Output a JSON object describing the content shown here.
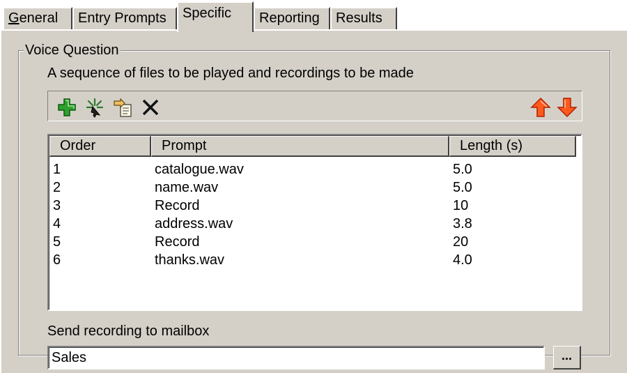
{
  "tabs": [
    {
      "label": "General",
      "access_key": "G",
      "rest": "eneral",
      "active": false
    },
    {
      "label": "Entry Prompts",
      "active": false
    },
    {
      "label": "Specific",
      "active": true
    },
    {
      "label": "Reporting",
      "active": false
    },
    {
      "label": "Results",
      "active": false
    }
  ],
  "group": {
    "title": "Voice Question",
    "description": "A sequence of files to be played and recordings to be made"
  },
  "toolbar": {
    "buttons": [
      {
        "icon": "add-icon",
        "tooltip": ""
      },
      {
        "icon": "new-recording-icon",
        "tooltip": ""
      },
      {
        "icon": "edit-icon",
        "tooltip": ""
      },
      {
        "icon": "delete-icon",
        "tooltip": ""
      },
      {
        "icon": "move-up-icon",
        "tooltip": ""
      },
      {
        "icon": "move-down-icon",
        "tooltip": ""
      }
    ],
    "colors": {
      "add": "#2fa02f",
      "arrows": "#ff5a1e"
    }
  },
  "list": {
    "columns": [
      "Order",
      "Prompt",
      "Length (s)"
    ],
    "rows": [
      {
        "order": "1",
        "prompt": "catalogue.wav",
        "length": "5.0"
      },
      {
        "order": "2",
        "prompt": "name.wav",
        "length": "5.0"
      },
      {
        "order": "3",
        "prompt": "Record",
        "length": "10"
      },
      {
        "order": "4",
        "prompt": "address.wav",
        "length": "3.8"
      },
      {
        "order": "5",
        "prompt": "Record",
        "length": "20"
      },
      {
        "order": "6",
        "prompt": "thanks.wav",
        "length": "4.0"
      }
    ]
  },
  "mailbox": {
    "label": "Send recording to mailbox",
    "value": "Sales",
    "browse_label": "..."
  }
}
